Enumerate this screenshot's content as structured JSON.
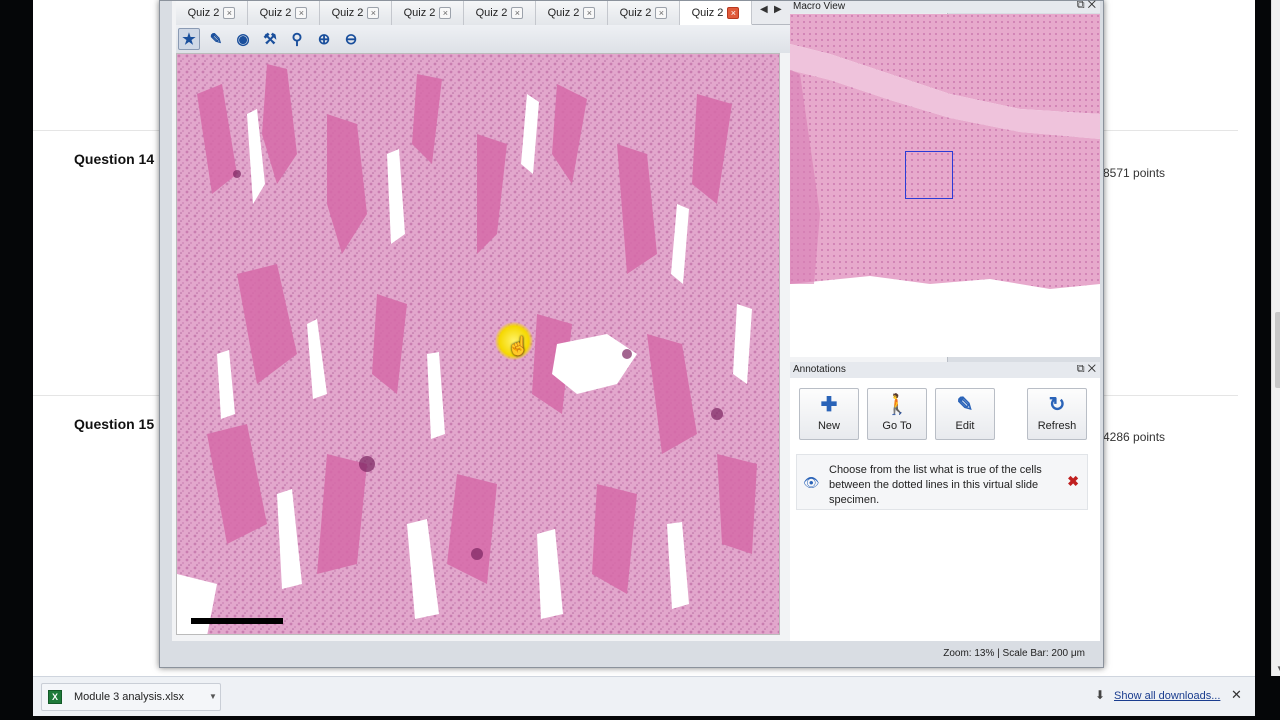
{
  "background_page": {
    "questions": [
      {
        "title": "Question 14",
        "points": "8571 points"
      },
      {
        "title": "Question 15",
        "points": "4286 points"
      }
    ]
  },
  "viewer": {
    "tabs": [
      {
        "label": "Quiz 2",
        "active": false
      },
      {
        "label": "Quiz 2",
        "active": false
      },
      {
        "label": "Quiz 2",
        "active": false
      },
      {
        "label": "Quiz 2",
        "active": false
      },
      {
        "label": "Quiz 2",
        "active": false
      },
      {
        "label": "Quiz 2",
        "active": false
      },
      {
        "label": "Quiz 2",
        "active": false
      },
      {
        "label": "Quiz 2",
        "active": true
      }
    ],
    "toolbar_icons": [
      "star-icon",
      "draw-icon",
      "eye-icon",
      "wrench-icon",
      "magnifier-icon",
      "zoom-in-icon",
      "zoom-out-icon"
    ],
    "macro_view": {
      "title": "Macro View"
    },
    "annotations": {
      "title": "Annotations",
      "buttons": {
        "new": "New",
        "goto": "Go To",
        "edit": "Edit",
        "refresh": "Refresh"
      },
      "items": [
        {
          "text": "Choose from the list what is true of the cells between the dotted lines in this virtual slide specimen."
        }
      ]
    },
    "status": "Zoom: 13% | Scale Bar: 200 μm"
  },
  "downloads": {
    "file": "Module 3 analysis.xlsx",
    "show_all": "Show all downloads..."
  }
}
